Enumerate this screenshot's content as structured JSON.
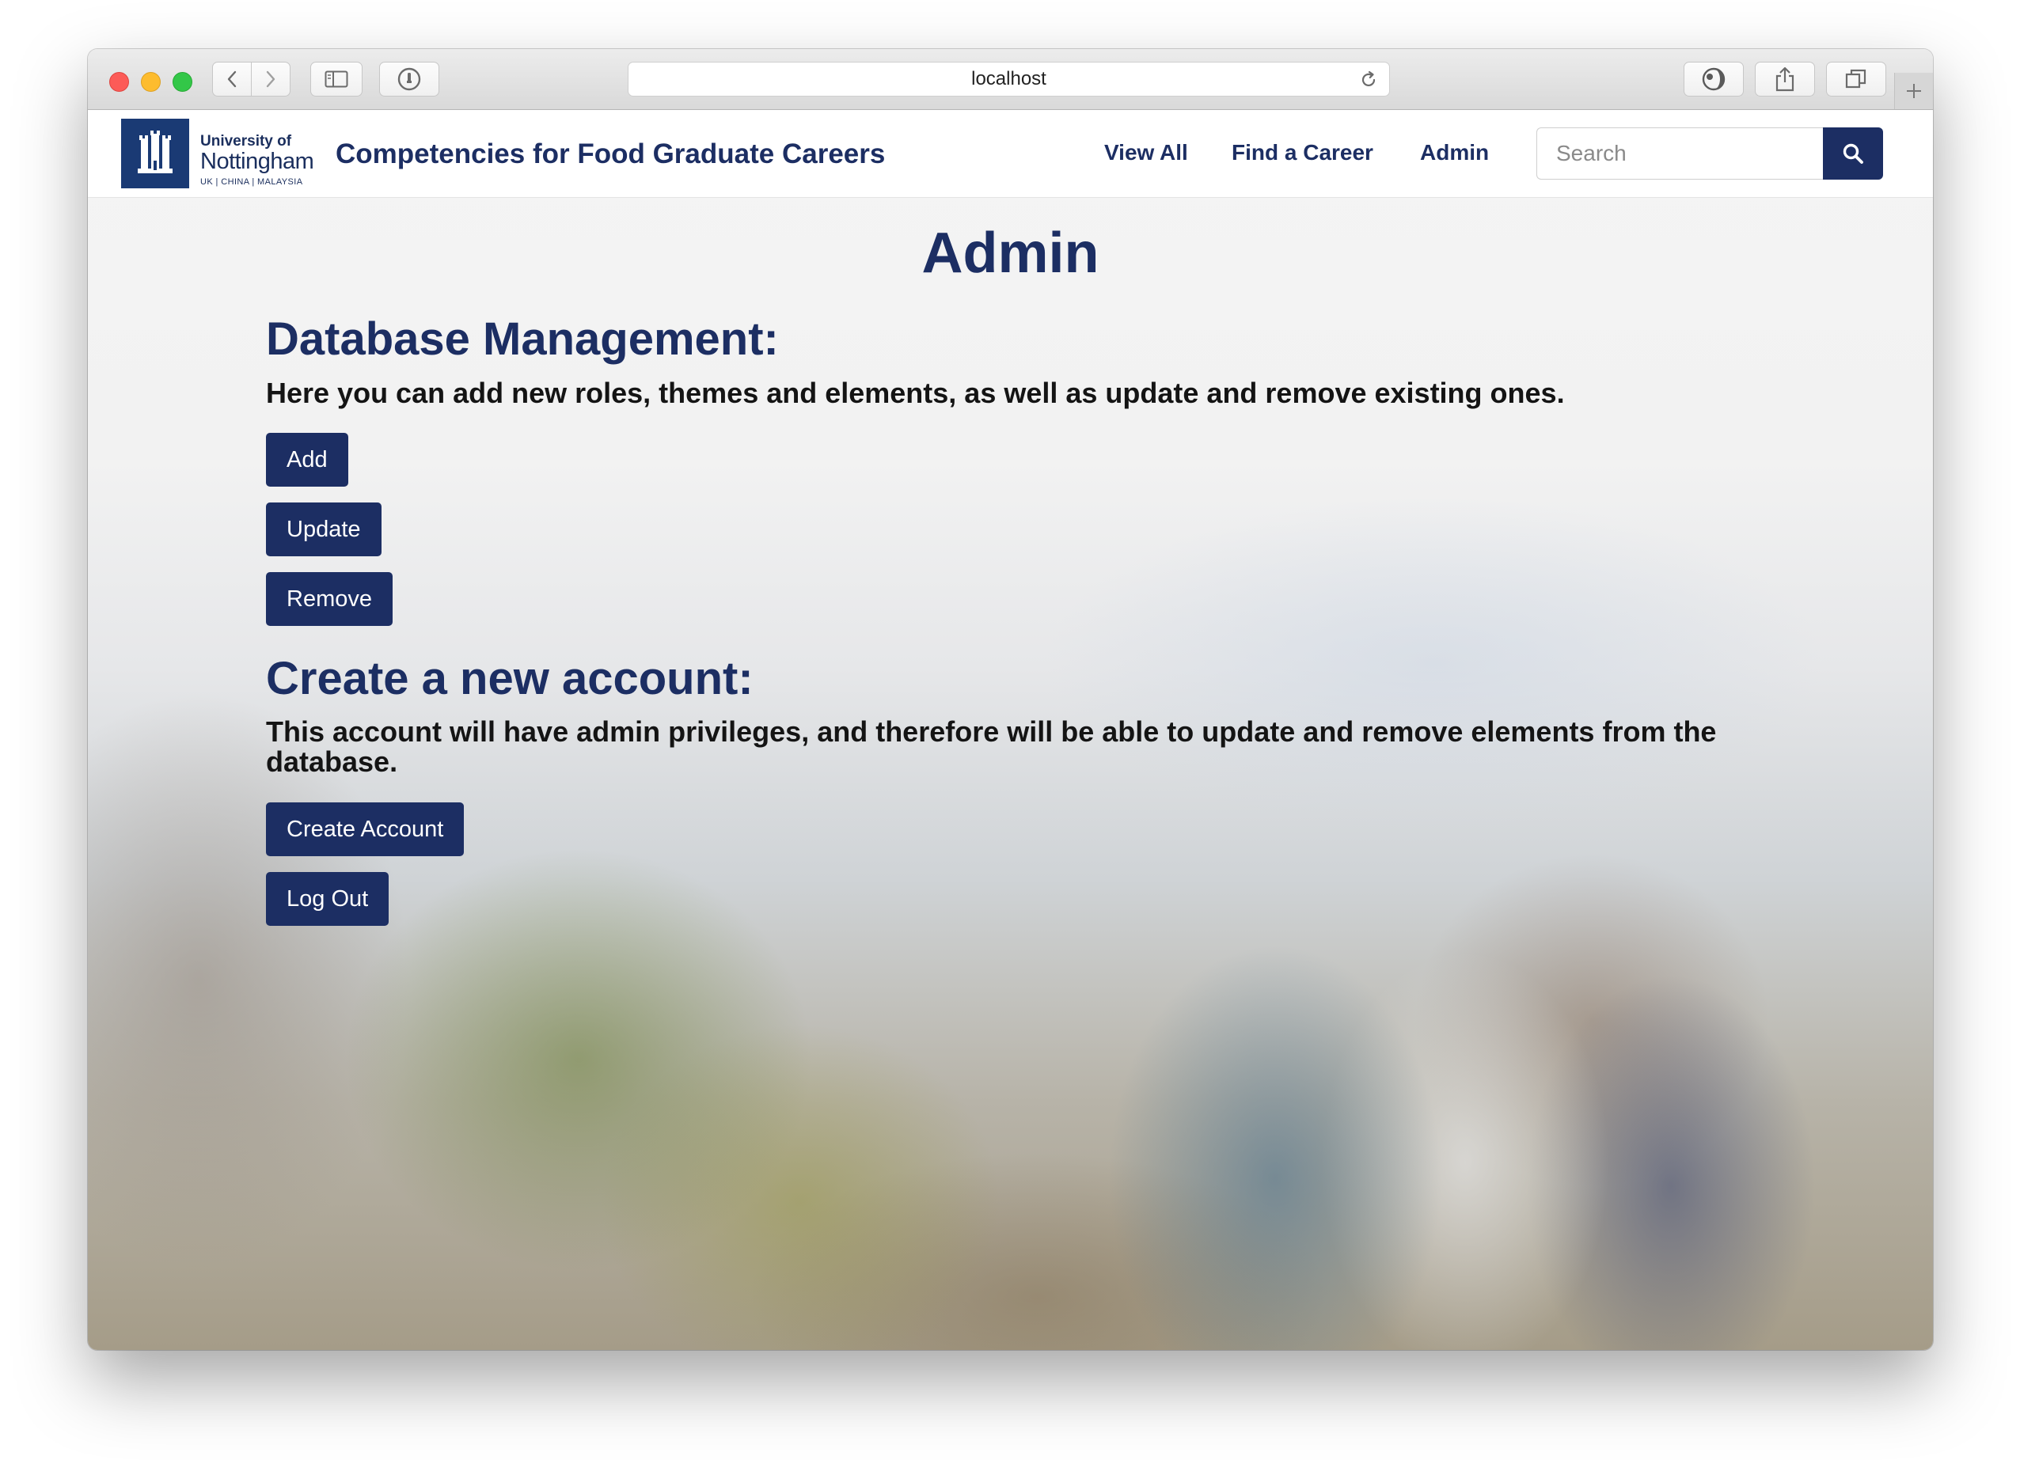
{
  "browser": {
    "url": "localhost"
  },
  "brand": {
    "logo_university": "University of",
    "logo_name": "Nottingham",
    "logo_sub": "UK | CHINA | MALAYSIA",
    "title": "Competencies for Food Graduate Careers"
  },
  "nav": {
    "view_all": "View All",
    "find_career": "Find a Career",
    "admin": "Admin"
  },
  "search": {
    "placeholder": "Search",
    "value": ""
  },
  "main": {
    "title": "Admin",
    "database": {
      "heading": "Database Management:",
      "description": "Here you can add new roles, themes and elements, as well as update and remove existing ones.",
      "add_label": "Add",
      "update_label": "Update",
      "remove_label": "Remove"
    },
    "account": {
      "heading": "Create a new account:",
      "description": "This account will have admin privileges, and therefore will be able to update and remove elements from the database.",
      "create_label": "Create Account",
      "logout_label": "Log Out"
    }
  },
  "colors": {
    "brand_navy": "#1c2e63",
    "crest_blue": "#1a3a74"
  }
}
